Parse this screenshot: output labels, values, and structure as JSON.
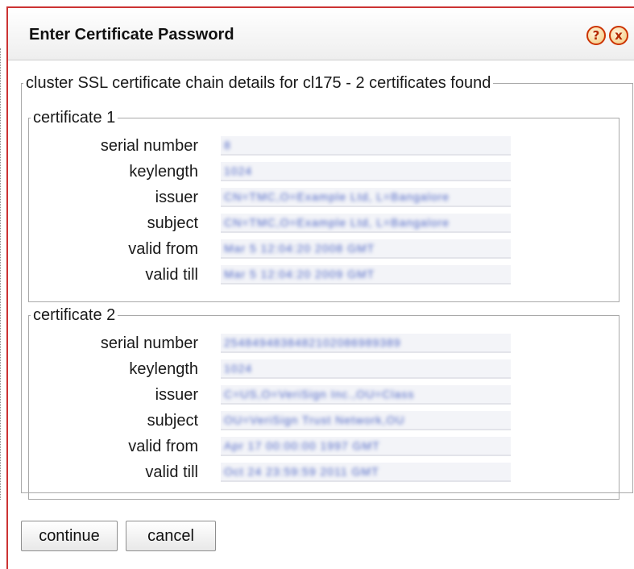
{
  "dialog": {
    "title": "Enter Certificate Password",
    "help_icon": "?",
    "close_icon": "x",
    "accent_color": "#cc3333"
  },
  "chain": {
    "legend": "cluster SSL certificate chain details for cl175 - 2 certificates found"
  },
  "certificates": [
    {
      "legend": "certificate 1",
      "fields": [
        {
          "label": "serial number",
          "value": "8"
        },
        {
          "label": "keylength",
          "value": "1024"
        },
        {
          "label": "issuer",
          "value": "CN=TMC,O=Example Ltd, L=Bangalore"
        },
        {
          "label": "subject",
          "value": "CN=TMC,O=Example Ltd, L=Bangalore"
        },
        {
          "label": "valid from",
          "value": "Mar 5 12:04:20 2008 GMT"
        },
        {
          "label": "valid till",
          "value": "Mar 5 12:04:20 2009 GMT"
        }
      ]
    },
    {
      "legend": "certificate 2",
      "fields": [
        {
          "label": "serial number",
          "value": "2548494838482102086989389"
        },
        {
          "label": "keylength",
          "value": "1024"
        },
        {
          "label": "issuer",
          "value": "C=US,O=VeriSign Inc.,OU=Class"
        },
        {
          "label": "subject",
          "value": "OU=VeriSign Trust Network,OU"
        },
        {
          "label": "valid from",
          "value": "Apr 17 00:00:00 1997 GMT"
        },
        {
          "label": "valid till",
          "value": "Oct 24 23:59:59 2011 GMT"
        }
      ]
    }
  ],
  "buttons": {
    "continue": "continue",
    "cancel": "cancel"
  }
}
